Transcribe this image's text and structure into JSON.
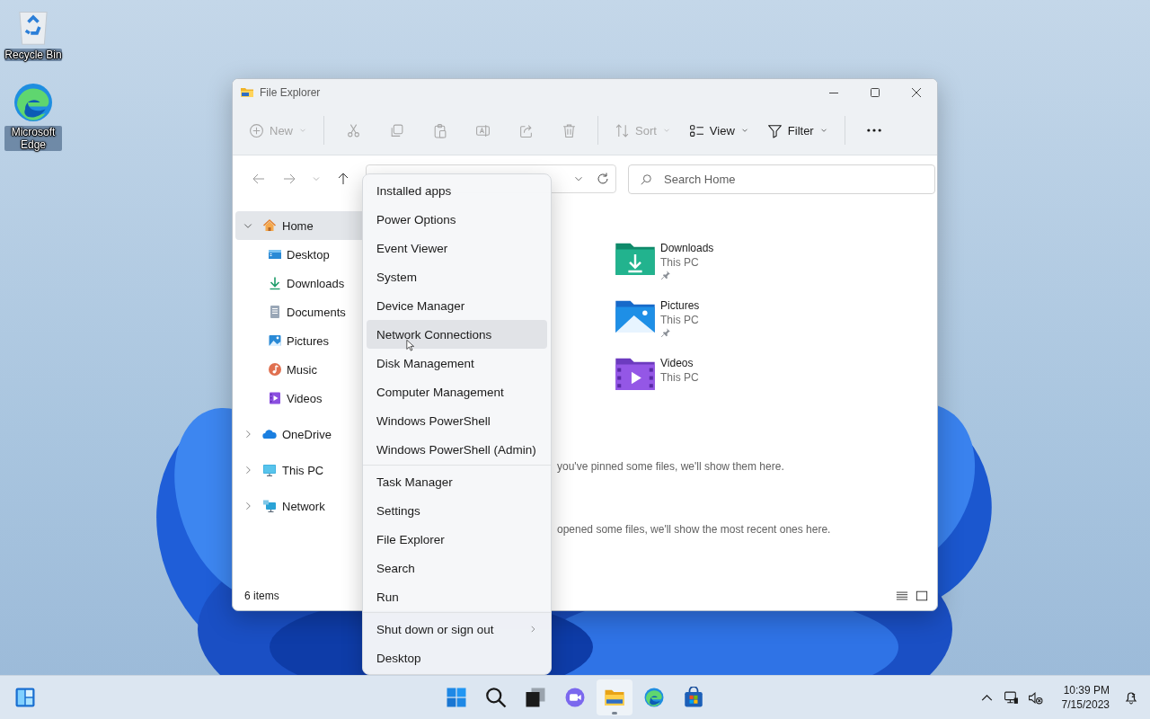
{
  "desktop_icons": [
    {
      "kind": "recycle-bin",
      "label": "Recycle Bin"
    },
    {
      "kind": "edge",
      "label": "Microsoft Edge"
    }
  ],
  "window": {
    "title": "File Explorer",
    "toolbar": [
      {
        "kind": "new",
        "label": "New",
        "disabled": true,
        "menu": true
      },
      {
        "kind": "separator"
      },
      {
        "kind": "cut",
        "disabled": true
      },
      {
        "kind": "copy",
        "disabled": true
      },
      {
        "kind": "paste",
        "disabled": true
      },
      {
        "kind": "rename",
        "disabled": true
      },
      {
        "kind": "share",
        "disabled": true
      },
      {
        "kind": "delete",
        "disabled": true
      },
      {
        "kind": "separator"
      },
      {
        "kind": "sort",
        "label": "Sort",
        "disabled": true,
        "menu": true
      },
      {
        "kind": "view",
        "label": "View",
        "disabled": false,
        "menu": true
      },
      {
        "kind": "filter",
        "label": "Filter",
        "disabled": false,
        "menu": true
      },
      {
        "kind": "separator"
      },
      {
        "kind": "more"
      }
    ],
    "nav": [
      {
        "kind": "back",
        "disabled": true
      },
      {
        "kind": "forward",
        "disabled": true
      },
      {
        "kind": "recent",
        "disabled": true
      },
      {
        "kind": "up",
        "disabled": false
      }
    ],
    "search": {
      "placeholder": "Search Home"
    },
    "sidebar": [
      {
        "kind": "home",
        "label": "Home",
        "expanded": true,
        "selected": true,
        "children": [
          {
            "kind": "desktop",
            "label": "Desktop",
            "selected": false
          },
          {
            "kind": "downloads",
            "label": "Downloads",
            "selected": false
          },
          {
            "kind": "documents",
            "label": "Documents",
            "selected": false
          },
          {
            "kind": "pictures",
            "label": "Pictures",
            "selected": false
          },
          {
            "kind": "music",
            "label": "Music",
            "selected": false
          },
          {
            "kind": "videos",
            "label": "Videos",
            "selected": false
          }
        ]
      },
      {
        "kind": "onedrive",
        "label": "OneDrive",
        "expanded": false,
        "selected": false
      },
      {
        "kind": "thispc",
        "label": "This PC",
        "expanded": false,
        "selected": false
      },
      {
        "kind": "network",
        "label": "Network",
        "expanded": false,
        "selected": false
      }
    ],
    "quick_access": [
      {
        "kind": "downloads",
        "name": "Downloads",
        "location": "This PC",
        "pinned": true
      },
      {
        "kind": "pictures",
        "name": "Pictures",
        "location": "This PC",
        "pinned": true
      },
      {
        "kind": "videos",
        "name": "Videos",
        "location": "This PC",
        "pinned": false
      }
    ],
    "messages": [
      "you've pinned some files, we'll show them here.",
      "opened some files, we'll show the most recent ones here."
    ],
    "status_bar": {
      "item_count": "6 items"
    }
  },
  "context_menu": {
    "groups": [
      [
        {
          "label": "Installed apps",
          "hovered": false,
          "submenu": false
        },
        {
          "label": "Power Options",
          "hovered": false,
          "submenu": false
        },
        {
          "label": "Event Viewer",
          "hovered": false,
          "submenu": false
        },
        {
          "label": "System",
          "hovered": false,
          "submenu": false
        },
        {
          "label": "Device Manager",
          "hovered": false,
          "submenu": false
        },
        {
          "label": "Network Connections",
          "hovered": true,
          "submenu": false
        },
        {
          "label": "Disk Management",
          "hovered": false,
          "submenu": false
        },
        {
          "label": "Computer Management",
          "hovered": false,
          "submenu": false
        },
        {
          "label": "Windows PowerShell",
          "hovered": false,
          "submenu": false
        },
        {
          "label": "Windows PowerShell (Admin)",
          "hovered": false,
          "submenu": false
        }
      ],
      [
        {
          "label": "Task Manager",
          "hovered": false,
          "submenu": false
        },
        {
          "label": "Settings",
          "hovered": false,
          "submenu": false
        },
        {
          "label": "File Explorer",
          "hovered": false,
          "submenu": false
        },
        {
          "label": "Search",
          "hovered": false,
          "submenu": false
        },
        {
          "label": "Run",
          "hovered": false,
          "submenu": false
        }
      ],
      [
        {
          "label": "Shut down or sign out",
          "hovered": false,
          "submenu": true
        },
        {
          "label": "Desktop",
          "hovered": false,
          "submenu": false
        }
      ]
    ]
  },
  "taskbar": {
    "widgets": {
      "kind": "widgets"
    },
    "apps": [
      {
        "kind": "start",
        "running": false
      },
      {
        "kind": "search",
        "running": false
      },
      {
        "kind": "taskview",
        "running": false
      },
      {
        "kind": "chat",
        "running": false
      },
      {
        "kind": "explorer",
        "running": true
      },
      {
        "kind": "edge",
        "running": false
      },
      {
        "kind": "store",
        "running": false
      }
    ],
    "tray": [
      {
        "kind": "chevron"
      },
      {
        "kind": "network"
      },
      {
        "kind": "muted"
      }
    ],
    "clock": {
      "time": "10:39 PM",
      "date": "7/15/2023"
    }
  }
}
